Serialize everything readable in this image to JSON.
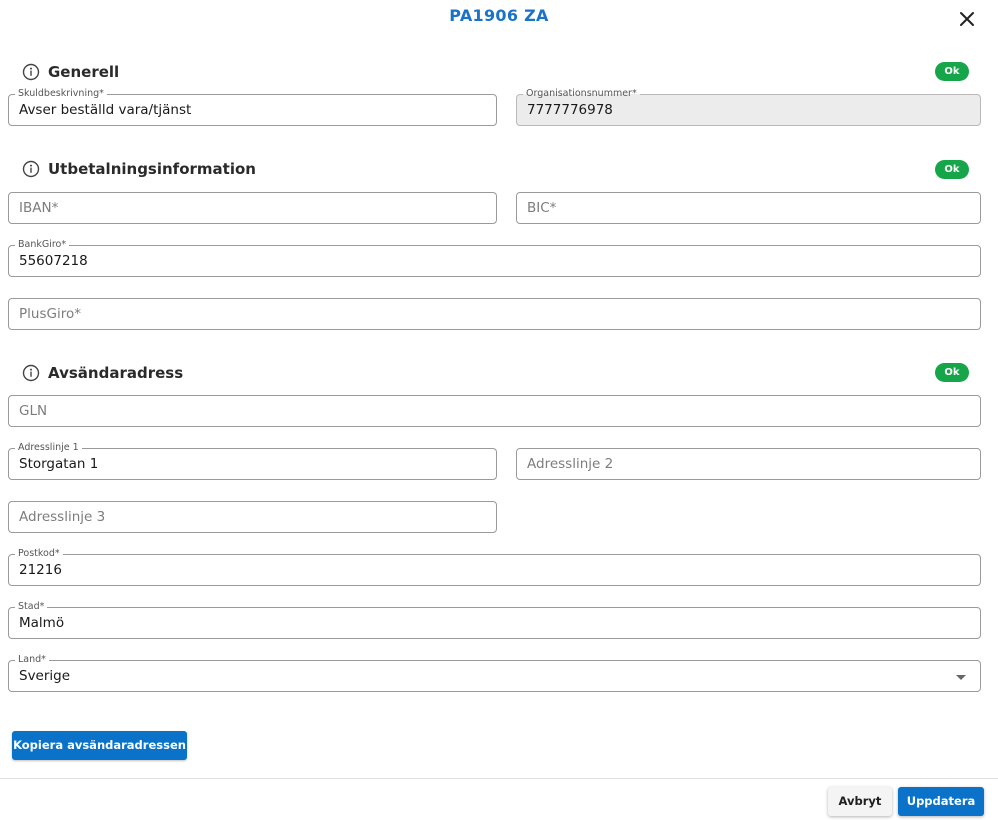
{
  "dialog": {
    "title": "PA1906 ZA",
    "close_icon": "close-icon"
  },
  "sections": {
    "general": {
      "title": "Generell",
      "badge": "Ok",
      "icon": "info-icon"
    },
    "payout": {
      "title": "Utbetalningsinformation",
      "badge": "Ok",
      "icon": "info-icon"
    },
    "sender": {
      "title": "Avsändaradress",
      "badge": "Ok",
      "icon": "info-icon"
    }
  },
  "fields": {
    "debt_description": {
      "label": "Skuldbeskrivning*",
      "value": "Avser beställd vara/tjänst"
    },
    "org_number": {
      "label": "Organisationsnummer*",
      "value": "7777776978"
    },
    "iban": {
      "placeholder": "IBAN*"
    },
    "bic": {
      "placeholder": "BIC*"
    },
    "bankgiro": {
      "label": "BankGiro*",
      "value": "55607218"
    },
    "plusgiro": {
      "placeholder": "PlusGiro*"
    },
    "gln": {
      "placeholder": "GLN"
    },
    "address_line_1": {
      "label": "Adresslinje 1",
      "value": "Storgatan 1"
    },
    "address_line_2": {
      "placeholder": "Adresslinje 2"
    },
    "address_line_3": {
      "placeholder": "Adresslinje 3"
    },
    "postal_code": {
      "label": "Postkod*",
      "value": "21216"
    },
    "city": {
      "label": "Stad*",
      "value": "Malmö"
    },
    "country": {
      "label": "Land*",
      "value": "Sverige"
    }
  },
  "buttons": {
    "copy_sender_address": "Kopiera avsändaradressen",
    "cancel": "Avbryt",
    "update": "Uppdatera"
  },
  "colors": {
    "accent": "#0a72c9",
    "title": "#1a73c8",
    "ok_badge": "#17a54a"
  }
}
